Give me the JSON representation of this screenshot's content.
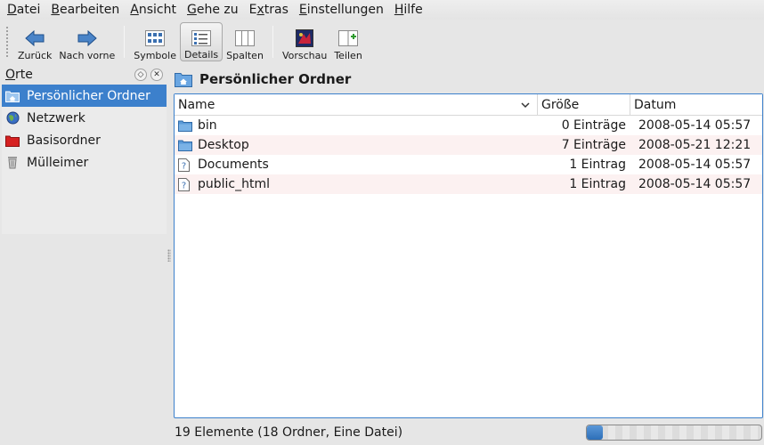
{
  "menubar": {
    "items": [
      {
        "accel": "D",
        "rest": "atei"
      },
      {
        "accel": "B",
        "rest": "earbeiten"
      },
      {
        "accel": "A",
        "rest": "nsicht"
      },
      {
        "accel": "G",
        "rest": "ehe zu"
      },
      {
        "accel": "E",
        "rest": "xtras",
        "prefix": ""
      },
      {
        "accel": "E",
        "rest": "instellungen"
      },
      {
        "accel": "H",
        "rest": "ilfe"
      }
    ]
  },
  "toolbar": {
    "back_label": "Zurück",
    "forward_label": "Nach vorne",
    "icons_label": "Symbole",
    "details_label": "Details",
    "columns_label": "Spalten",
    "preview_label": "Vorschau",
    "split_label": "Teilen",
    "active_view": "Details"
  },
  "places": {
    "title_accel": "O",
    "title_rest": "rte",
    "items": [
      {
        "label": "Persönlicher Ordner",
        "icon": "home-folder-icon",
        "selected": true
      },
      {
        "label": "Netzwerk",
        "icon": "network-globe-icon",
        "selected": false
      },
      {
        "label": "Basisordner",
        "icon": "root-folder-icon",
        "selected": false
      },
      {
        "label": "Mülleimer",
        "icon": "trash-icon",
        "selected": false
      }
    ]
  },
  "location": {
    "title": "Persönlicher Ordner",
    "icon": "home-folder-icon"
  },
  "fileview": {
    "columns": {
      "name": "Name",
      "size": "Größe",
      "date": "Datum"
    },
    "rows": [
      {
        "name": "bin",
        "size": "0 Einträge",
        "date": "2008-05-14 05:57",
        "icon": "folder-icon"
      },
      {
        "name": "Desktop",
        "size": "7 Einträge",
        "date": "2008-05-21 12:21",
        "icon": "folder-icon"
      },
      {
        "name": "Documents",
        "size": "1 Eintrag",
        "date": "2008-05-14 05:57",
        "icon": "unknown-file-icon"
      },
      {
        "name": "public_html",
        "size": "1 Eintrag",
        "date": "2008-05-14 05:57",
        "icon": "unknown-file-icon"
      }
    ]
  },
  "statusbar": {
    "text": "19 Elemente (18 Ordner, Eine Datei)",
    "disk_usage_fraction": 0.09
  },
  "colors": {
    "selection": "#3c80cc",
    "alt_row": "#fcf1f1",
    "folder_blue": "#5a9ad8"
  }
}
